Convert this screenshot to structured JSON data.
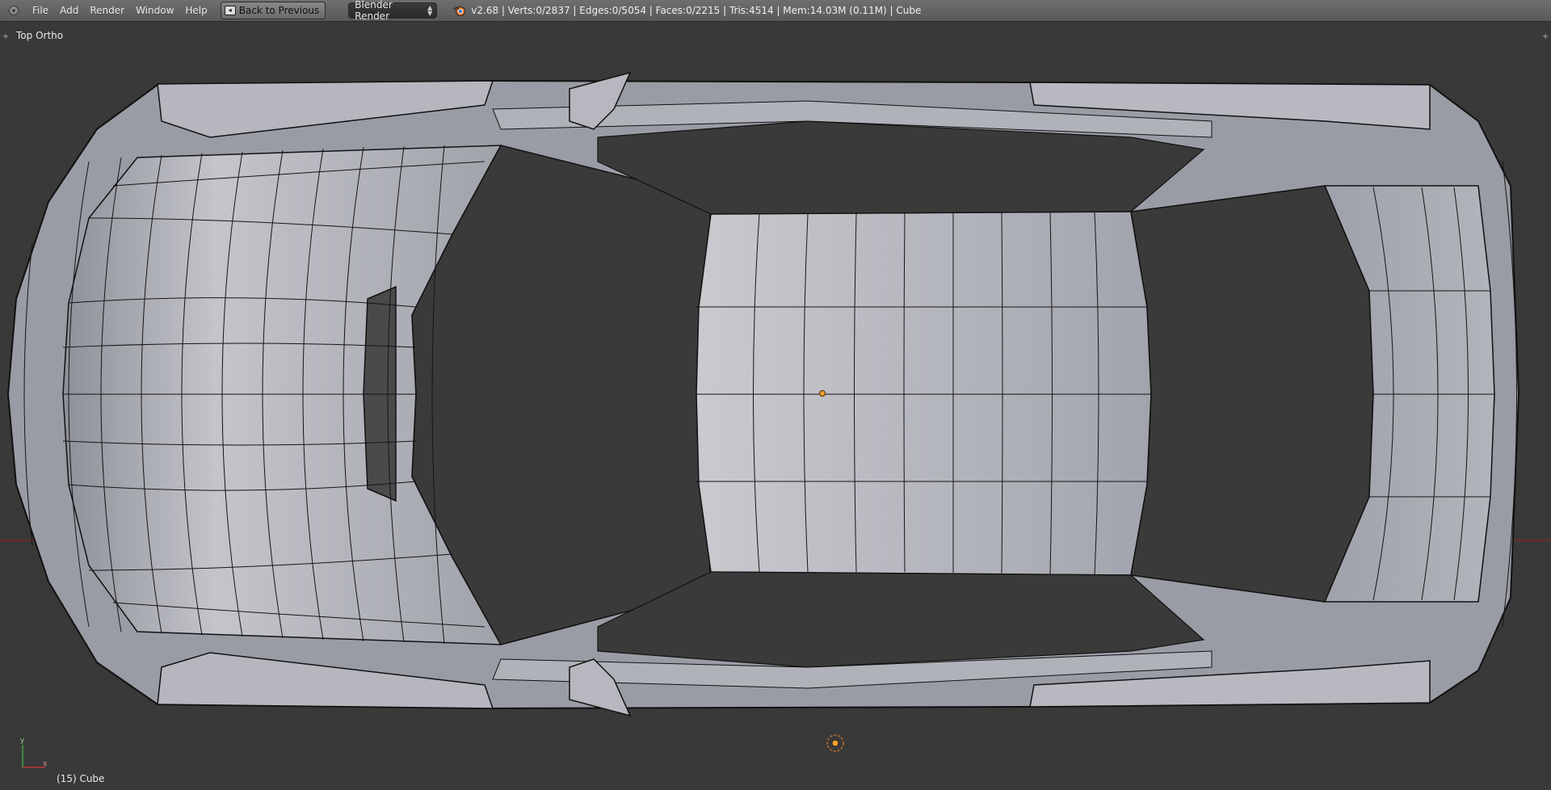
{
  "header": {
    "menu": [
      "File",
      "Add",
      "Render",
      "Window",
      "Help"
    ],
    "back_button": "Back to Previous",
    "render_engine": "Blender Render",
    "stats": "v2.68 | Verts:0/2837 | Edges:0/5054 | Faces:0/2215 | Tris:4514 | Mem:14.03M (0.11M) | Cube"
  },
  "viewport": {
    "view_name": "Top Ortho",
    "object_info": "(15) Cube"
  },
  "icons": {
    "header_toggle": "editor-type-icon",
    "back": "back-arrow-icon",
    "engine_arrows": "up-down-arrows-icon",
    "logo": "blender-logo-icon",
    "axis": "axis-widget-icon",
    "lamp": "lamp-icon",
    "origin": "object-origin-icon"
  },
  "colors": {
    "background": "#393939",
    "header": "#626262",
    "mesh_fill": "#a7a9b1",
    "mesh_wire": "#101010",
    "x_axis": "#8f2b2b",
    "accent_orange": "#f0a030"
  }
}
